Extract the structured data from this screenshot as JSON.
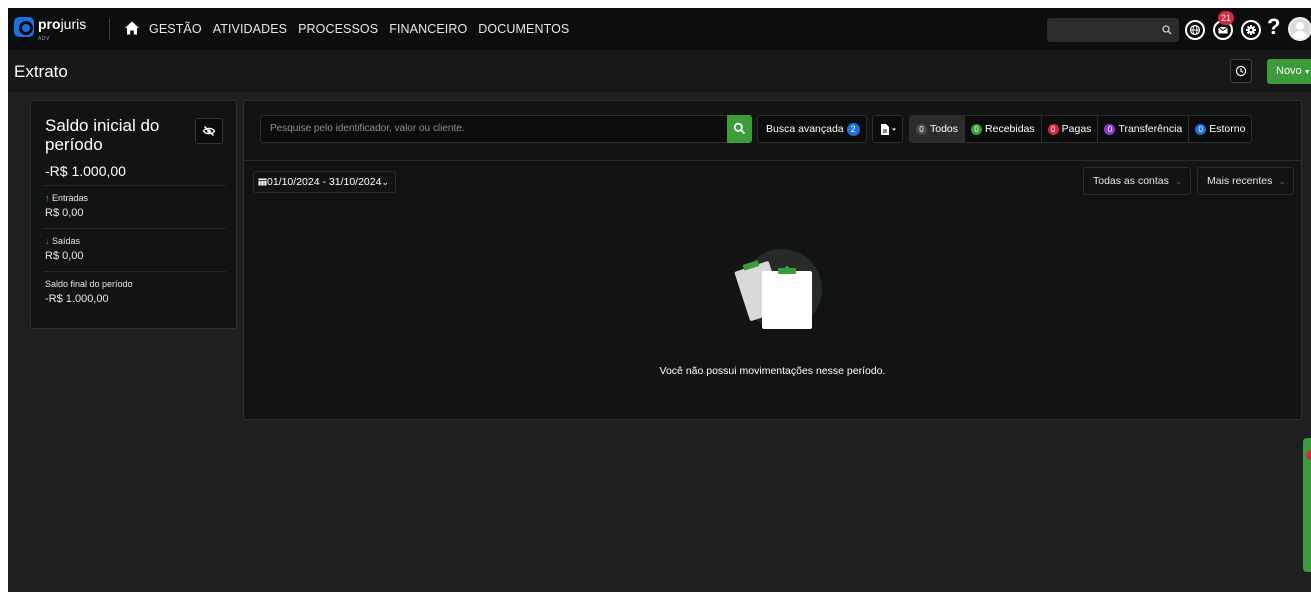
{
  "app": {
    "logo_bold": "pro",
    "logo_light": "juris",
    "logo_sub": "ADV"
  },
  "nav": {
    "items": [
      "GESTÃO",
      "ATIVIDADES",
      "PROCESSOS",
      "FINANCEIRO",
      "DOCUMENTOS"
    ]
  },
  "topbar": {
    "notification_count": "21",
    "help_label": "?",
    "icons": [
      "home-icon",
      "search-icon",
      "globe-icon",
      "mail-icon",
      "gear-icon",
      "help-icon",
      "avatar"
    ]
  },
  "page": {
    "title": "Extrato",
    "new_button": "Novo"
  },
  "balance": {
    "title": "Saldo inicial do período",
    "initial_amount": "-R$ 1.000,00",
    "entradas_label": "Entradas",
    "entradas_value": "R$ 0,00",
    "saidas_label": "Saídas",
    "saidas_value": "R$ 0,00",
    "final_label": "Saldo final do período",
    "final_value": "-R$ 1.000,00"
  },
  "search": {
    "placeholder": "Pesquise pelo identificador, valor ou cliente.",
    "advanced_label": "Busca avançada",
    "advanced_count": "2"
  },
  "filters": [
    {
      "count": "0",
      "label": "Todos",
      "color": "#4a4f4d"
    },
    {
      "count": "0",
      "label": "Recebidas",
      "color": "#3d9c3a"
    },
    {
      "count": "0",
      "label": "Pagas",
      "color": "#d7263d"
    },
    {
      "count": "0",
      "label": "Transferência",
      "color": "#8a3bd1"
    },
    {
      "count": "0",
      "label": "Estorno",
      "color": "#1e6fe0"
    }
  ],
  "period": {
    "range": "01/10/2024 - 31/10/2024"
  },
  "selects": {
    "accounts": "Todas as contas",
    "order": "Mais recentes"
  },
  "empty": {
    "message": "Você não possui movimentações nesse período."
  },
  "colors": {
    "accent_green": "#3d9c3a",
    "accent_blue": "#1e6fe0",
    "danger_red": "#d7263d",
    "background": "#1e201f"
  }
}
